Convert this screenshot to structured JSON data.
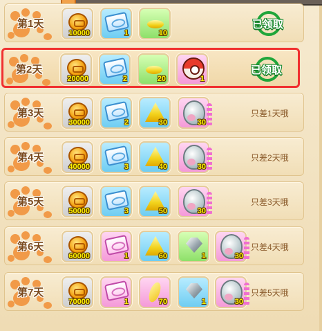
{
  "colors": {
    "accent": "#f03030",
    "claimed_green": "#1fa63a",
    "remaining_text": "#8a5a2a",
    "qty_yellow": "#fff200"
  },
  "rows": [
    {
      "day": "第1天",
      "status": "已领取",
      "highlight": false,
      "items": [
        {
          "icon": "gold-coin-icon",
          "bg": "gray",
          "qty": "10000"
        },
        {
          "icon": "blue-scroll-icon",
          "bg": "blue",
          "qty": "1"
        },
        {
          "icon": "gold-pile-icon",
          "bg": "green",
          "qty": "10"
        }
      ]
    },
    {
      "day": "第2天",
      "status": "已领取",
      "highlight": true,
      "items": [
        {
          "icon": "gold-coin-icon",
          "bg": "gray",
          "qty": "20000"
        },
        {
          "icon": "blue-scroll-icon",
          "bg": "blue",
          "qty": "2"
        },
        {
          "icon": "gold-pile-icon",
          "bg": "green",
          "qty": "20"
        },
        {
          "icon": "pokeball-icon",
          "bg": "pink",
          "qty": "1"
        }
      ]
    },
    {
      "day": "第3天",
      "status": "只差1天哦",
      "highlight": false,
      "items": [
        {
          "icon": "gold-coin-icon",
          "bg": "gray",
          "qty": "30000"
        },
        {
          "icon": "blue-scroll-icon",
          "bg": "blue",
          "qty": "2"
        },
        {
          "icon": "gold-pile-icon",
          "bg": "blue",
          "qty": "30"
        },
        {
          "icon": "pet-egg-icon",
          "bg": "pink",
          "qty": "30"
        }
      ]
    },
    {
      "day": "第4天",
      "status": "只差2天哦",
      "highlight": false,
      "items": [
        {
          "icon": "gold-coin-icon",
          "bg": "gray",
          "qty": "40000"
        },
        {
          "icon": "blue-scroll-icon",
          "bg": "blue",
          "qty": "3"
        },
        {
          "icon": "gold-pile-icon",
          "bg": "blue",
          "qty": "40"
        },
        {
          "icon": "pet-egg-icon",
          "bg": "pink",
          "qty": "30"
        }
      ]
    },
    {
      "day": "第5天",
      "status": "只差3天哦",
      "highlight": false,
      "items": [
        {
          "icon": "gold-coin-icon",
          "bg": "gray",
          "qty": "50000"
        },
        {
          "icon": "blue-scroll-icon",
          "bg": "blue",
          "qty": "3"
        },
        {
          "icon": "gold-pile-icon",
          "bg": "blue",
          "qty": "50"
        },
        {
          "icon": "pet-egg-icon",
          "bg": "pink",
          "qty": "30"
        }
      ]
    },
    {
      "day": "第6天",
      "status": "只差4天哦",
      "highlight": false,
      "items": [
        {
          "icon": "gold-coin-icon",
          "bg": "gray",
          "qty": "60000"
        },
        {
          "icon": "pink-scroll-icon",
          "bg": "pink",
          "qty": "1"
        },
        {
          "icon": "gold-pile-icon",
          "bg": "blue",
          "qty": "60"
        },
        {
          "icon": "silver-gem-icon",
          "bg": "green",
          "qty": "1"
        },
        {
          "icon": "pet-egg-icon",
          "bg": "pink",
          "qty": "30"
        }
      ]
    },
    {
      "day": "第7天",
      "status": "只差5天哦",
      "highlight": false,
      "items": [
        {
          "icon": "gold-coin-icon",
          "bg": "gray",
          "qty": "70000"
        },
        {
          "icon": "pink-scroll-icon",
          "bg": "pink",
          "qty": "1"
        },
        {
          "icon": "gold-feather-icon",
          "bg": "pink",
          "qty": "70"
        },
        {
          "icon": "silver-gem-icon",
          "bg": "blue",
          "qty": "1"
        },
        {
          "icon": "pet-egg-icon",
          "bg": "pink",
          "qty": "30"
        }
      ]
    }
  ]
}
